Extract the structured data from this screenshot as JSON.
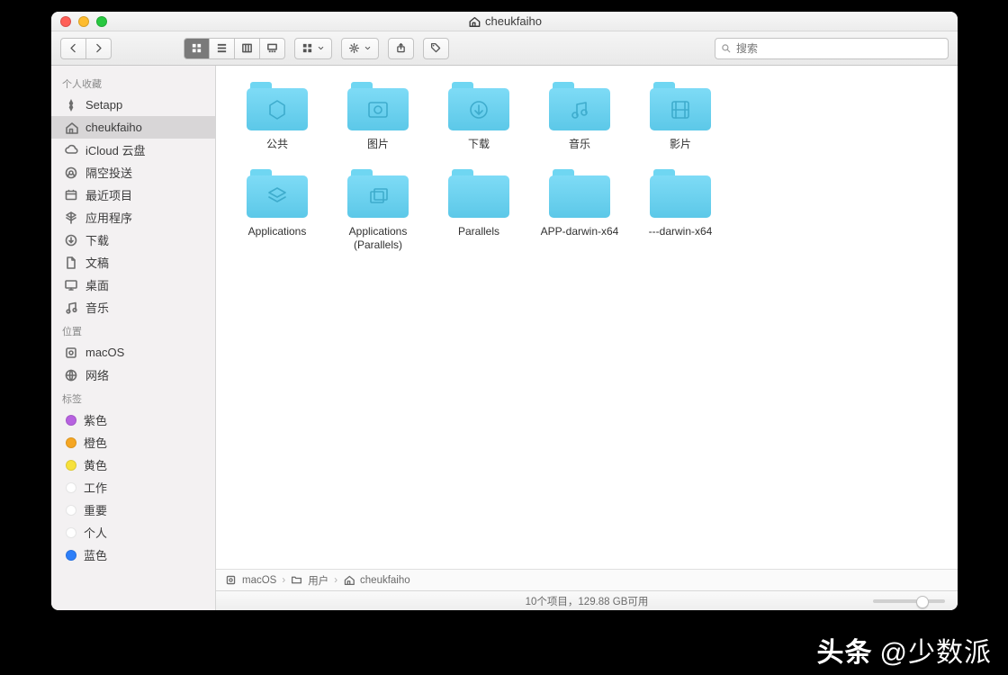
{
  "window": {
    "title": "cheukfaiho"
  },
  "search": {
    "placeholder": "搜索"
  },
  "sidebar": {
    "sections": [
      {
        "header": "个人收藏",
        "items": [
          {
            "label": "Setapp",
            "icon": "setapp",
            "selected": false
          },
          {
            "label": "cheukfaiho",
            "icon": "home",
            "selected": true
          },
          {
            "label": "iCloud 云盘",
            "icon": "cloud",
            "selected": false
          },
          {
            "label": "隔空投送",
            "icon": "airdrop",
            "selected": false
          },
          {
            "label": "最近项目",
            "icon": "recent",
            "selected": false
          },
          {
            "label": "应用程序",
            "icon": "apps",
            "selected": false
          },
          {
            "label": "下载",
            "icon": "download",
            "selected": false
          },
          {
            "label": "文稿",
            "icon": "document",
            "selected": false
          },
          {
            "label": "桌面",
            "icon": "desktop",
            "selected": false
          },
          {
            "label": "音乐",
            "icon": "music",
            "selected": false
          }
        ]
      },
      {
        "header": "位置",
        "items": [
          {
            "label": "macOS",
            "icon": "disk",
            "selected": false
          },
          {
            "label": "网络",
            "icon": "network",
            "selected": false
          }
        ]
      },
      {
        "header": "标签",
        "items": [
          {
            "label": "紫色",
            "icon": "tag",
            "color": "#b762e0"
          },
          {
            "label": "橙色",
            "icon": "tag",
            "color": "#f5a623"
          },
          {
            "label": "黄色",
            "icon": "tag",
            "color": "#f7e13b"
          },
          {
            "label": "工作",
            "icon": "tag",
            "color": "#ffffff"
          },
          {
            "label": "重要",
            "icon": "tag",
            "color": "#ffffff"
          },
          {
            "label": "个人",
            "icon": "tag",
            "color": "#ffffff"
          },
          {
            "label": "蓝色",
            "icon": "tag",
            "color": "#2d7ff9"
          }
        ]
      }
    ]
  },
  "items": [
    {
      "name": "公共",
      "glyph": "public"
    },
    {
      "name": "图片",
      "glyph": "pictures"
    },
    {
      "name": "下载",
      "glyph": "downloads"
    },
    {
      "name": "音乐",
      "glyph": "music"
    },
    {
      "name": "影片",
      "glyph": "movies"
    },
    {
      "name": "Applications",
      "glyph": "apps"
    },
    {
      "name": "Applications (Parallels)",
      "glyph": "windows"
    },
    {
      "name": "Parallels",
      "glyph": ""
    },
    {
      "name": "APP-darwin-x64",
      "glyph": ""
    },
    {
      "name": "---darwin-x64",
      "glyph": ""
    }
  ],
  "path": [
    {
      "label": "macOS",
      "icon": "disk"
    },
    {
      "label": "用户",
      "icon": "folder"
    },
    {
      "label": "cheukfaiho",
      "icon": "home"
    }
  ],
  "status": {
    "text": "10个项目，129.88 GB可用"
  },
  "watermark": {
    "prefix": "头条",
    "handle": "@少数派"
  }
}
